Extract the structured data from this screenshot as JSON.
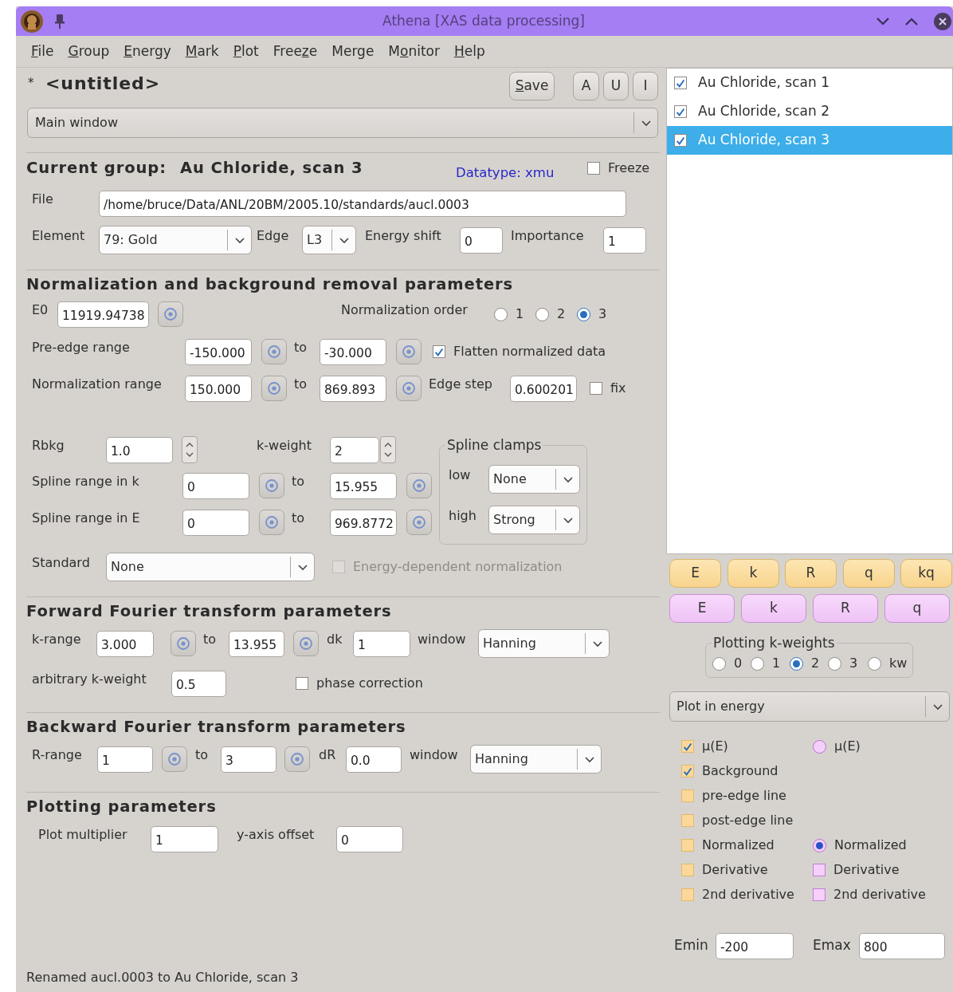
{
  "window": {
    "title": "Athena [XAS data processing]"
  },
  "menu": [
    {
      "key": "F",
      "after": "ile"
    },
    {
      "key": "G",
      "after": "roup"
    },
    {
      "key": "E",
      "after": "nergy"
    },
    {
      "key": "M",
      "after": "ark"
    },
    {
      "key": "P",
      "after": "lot"
    },
    {
      "before": "Free",
      "key": "z",
      "after": "e"
    },
    {
      "before": "Mer",
      "key": "g",
      "after": "e"
    },
    {
      "before": "M",
      "key": "o",
      "after": "nitor"
    },
    {
      "key": "H",
      "after": "elp"
    }
  ],
  "project": {
    "modified": "*",
    "name": "<untitled>"
  },
  "project_buttons": [
    {
      "key": "S",
      "after": "ave"
    },
    {
      "before": "A"
    },
    {
      "before": "U"
    },
    {
      "before": "I"
    }
  ],
  "view_selector": {
    "value": "Main window"
  },
  "current_group": {
    "label": "Current group:",
    "name": "Au Chloride, scan 3",
    "datatype": "Datatype: xmu",
    "freeze": {
      "label": "Freeze",
      "checked": false
    }
  },
  "sections": [
    {
      "rows": [
        {
          "kind": "line",
          "items": [
            {
              "kind": "label",
              "text": "File"
            },
            {
              "kind": "field",
              "value": "/home/bruce/Data/ANL/20BM/2005.10/standards/aucl.0003"
            }
          ]
        },
        {
          "kind": "line",
          "items": [
            {
              "kind": "label",
              "text": "Element"
            },
            {
              "kind": "select",
              "value": "79: Gold"
            },
            {
              "kind": "label",
              "text": "Edge"
            },
            {
              "kind": "select",
              "value": "L3"
            },
            {
              "kind": "label",
              "text": "Energy shift"
            },
            {
              "kind": "field",
              "value": "0"
            },
            {
              "kind": "label",
              "text": "Importance"
            },
            {
              "kind": "field",
              "value": "1"
            }
          ]
        }
      ]
    },
    {
      "title": "Normalization and background removal parameters",
      "rows": [
        {
          "kind": "line",
          "items": [
            {
              "kind": "label",
              "text": "E0"
            },
            {
              "kind": "field",
              "value": "11919.94738"
            },
            {
              "kind": "target"
            },
            {
              "kind": "label",
              "text": "Normalization order"
            },
            {
              "kind": "radio",
              "label": "1",
              "selected": false
            },
            {
              "kind": "radio",
              "label": "2",
              "selected": false
            },
            {
              "kind": "radio",
              "label": "3",
              "selected": true
            }
          ]
        },
        {
          "kind": "line",
          "items": [
            {
              "kind": "label",
              "text": "Pre-edge range"
            },
            {
              "kind": "field",
              "value": "-150.000"
            },
            {
              "kind": "target"
            },
            {
              "kind": "label",
              "text": "to"
            },
            {
              "kind": "field",
              "value": "-30.000"
            },
            {
              "kind": "target"
            },
            {
              "kind": "check",
              "label": "Flatten normalized data",
              "checked": true,
              "disabled": false
            }
          ]
        },
        {
          "kind": "line",
          "items": [
            {
              "kind": "label",
              "text": "Normalization range"
            },
            {
              "kind": "field",
              "value": "150.000"
            },
            {
              "kind": "target"
            },
            {
              "kind": "label",
              "text": "to"
            },
            {
              "kind": "field",
              "value": "869.893"
            },
            {
              "kind": "target"
            },
            {
              "kind": "label",
              "text": "Edge step"
            },
            {
              "kind": "field",
              "value": "0.600201"
            },
            {
              "kind": "check",
              "label": "fix",
              "checked": false,
              "disabled": false
            }
          ]
        },
        {
          "kind": "block",
          "rows": [
            {
              "kind": "line",
              "items": [
                {
                  "kind": "label",
                  "text": "Rbkg"
                },
                {
                  "kind": "field",
                  "value": "1.0"
                },
                {
                  "kind": "spin"
                },
                {
                  "kind": "label",
                  "text": "k-weight"
                },
                {
                  "kind": "field",
                  "value": "2"
                },
                {
                  "kind": "spin"
                }
              ]
            },
            {
              "kind": "line",
              "items": [
                {
                  "kind": "label",
                  "text": "Spline range in k"
                },
                {
                  "kind": "field",
                  "value": "0"
                },
                {
                  "kind": "target"
                },
                {
                  "kind": "label",
                  "text": "to"
                },
                {
                  "kind": "field",
                  "value": "15.955"
                },
                {
                  "kind": "target"
                }
              ]
            },
            {
              "kind": "line",
              "items": [
                {
                  "kind": "label",
                  "text": "Spline range in E"
                },
                {
                  "kind": "field",
                  "value": "0"
                },
                {
                  "kind": "target"
                },
                {
                  "kind": "label",
                  "text": "to"
                },
                {
                  "kind": "field",
                  "value": "969.8772"
                },
                {
                  "kind": "target"
                }
              ]
            }
          ],
          "clamps": {
            "title": "Spline clamps",
            "rows": [
              {
                "kind": "line",
                "items": [
                  {
                    "kind": "label",
                    "text": "low"
                  },
                  {
                    "kind": "select",
                    "value": "None"
                  }
                ]
              },
              {
                "kind": "line",
                "items": [
                  {
                    "kind": "label",
                    "text": "high"
                  },
                  {
                    "kind": "select",
                    "value": "Strong"
                  }
                ]
              }
            ]
          }
        },
        {
          "kind": "line",
          "items": [
            {
              "kind": "label",
              "text": "Standard"
            },
            {
              "kind": "select",
              "value": "None"
            },
            {
              "kind": "check",
              "label": "Energy-dependent normalization",
              "checked": false,
              "disabled": true
            }
          ]
        }
      ]
    },
    {
      "title": "Forward Fourier transform parameters",
      "rows": [
        {
          "kind": "line",
          "items": [
            {
              "kind": "label",
              "text": "k-range"
            },
            {
              "kind": "field",
              "value": "3.000"
            },
            {
              "kind": "target"
            },
            {
              "kind": "label",
              "text": "to"
            },
            {
              "kind": "field",
              "value": "13.955"
            },
            {
              "kind": "target"
            },
            {
              "kind": "label",
              "text": "dk"
            },
            {
              "kind": "field",
              "value": "1"
            },
            {
              "kind": "label",
              "text": "window"
            },
            {
              "kind": "select",
              "value": "Hanning"
            }
          ]
        },
        {
          "kind": "line",
          "items": [
            {
              "kind": "label",
              "text": "arbitrary k-weight"
            },
            {
              "kind": "field",
              "value": "0.5"
            },
            {
              "kind": "check",
              "label": "phase correction",
              "checked": false,
              "disabled": false
            }
          ]
        }
      ]
    },
    {
      "title": "Backward Fourier transform parameters",
      "rows": [
        {
          "kind": "line",
          "items": [
            {
              "kind": "label",
              "text": "R-range"
            },
            {
              "kind": "field",
              "value": "1"
            },
            {
              "kind": "target"
            },
            {
              "kind": "label",
              "text": "to"
            },
            {
              "kind": "field",
              "value": "3"
            },
            {
              "kind": "target"
            },
            {
              "kind": "label",
              "text": "dR"
            },
            {
              "kind": "field",
              "value": "0.0"
            },
            {
              "kind": "label",
              "text": "window"
            },
            {
              "kind": "select",
              "value": "Hanning"
            }
          ]
        }
      ]
    },
    {
      "title": "Plotting parameters",
      "rows": [
        {
          "kind": "line",
          "items": [
            {
              "kind": "label",
              "text": "Plot multiplier"
            },
            {
              "kind": "field",
              "value": "1"
            },
            {
              "kind": "label",
              "text": "y-axis offset"
            },
            {
              "kind": "field",
              "value": "0"
            }
          ]
        }
      ]
    }
  ],
  "status_bar": "Renamed aucl.0003 to Au Chloride, scan 3",
  "groups": [
    {
      "name": "Au Chloride, scan 1",
      "checked": true,
      "selected": false
    },
    {
      "name": "Au Chloride, scan 2",
      "checked": true,
      "selected": false
    },
    {
      "name": "Au Chloride, scan 3",
      "checked": true,
      "selected": true
    }
  ],
  "single_plot_buttons": [
    "E",
    "k",
    "R",
    "q",
    "kq"
  ],
  "marked_plot_buttons": [
    "E",
    "k",
    "R",
    "q"
  ],
  "k_weights": {
    "title": "Plotting k-weights",
    "options": [
      {
        "label": "0",
        "selected": false
      },
      {
        "label": "1",
        "selected": false
      },
      {
        "label": "2",
        "selected": true
      },
      {
        "label": "3",
        "selected": false
      },
      {
        "label": "kw",
        "selected": false
      }
    ]
  },
  "plot_space": {
    "value": "Plot in energy"
  },
  "plot_options": [
    {
      "single": {
        "kind": "check",
        "label": "μ(E)",
        "checked": true
      },
      "marked": {
        "kind": "radio",
        "label": "μ(E)",
        "selected": false
      }
    },
    {
      "single": {
        "kind": "check",
        "label": "Background",
        "checked": true
      }
    },
    {
      "single": {
        "kind": "check",
        "label": "pre-edge line",
        "checked": false
      }
    },
    {
      "single": {
        "kind": "check",
        "label": "post-edge line",
        "checked": false
      }
    },
    {
      "single": {
        "kind": "check",
        "label": "Normalized",
        "checked": false
      },
      "marked": {
        "kind": "radio",
        "label": "Normalized",
        "selected": true
      }
    },
    {
      "single": {
        "kind": "check",
        "label": "Derivative",
        "checked": false
      },
      "marked": {
        "kind": "check",
        "label": "Derivative",
        "checked": false
      }
    },
    {
      "single": {
        "kind": "check",
        "label": "2nd derivative",
        "checked": false
      },
      "marked": {
        "kind": "check",
        "label": "2nd derivative",
        "checked": false
      }
    }
  ],
  "energy_range": [
    {
      "label": "Emin",
      "value": "-200"
    },
    {
      "label": "Emax",
      "value": "800"
    }
  ]
}
